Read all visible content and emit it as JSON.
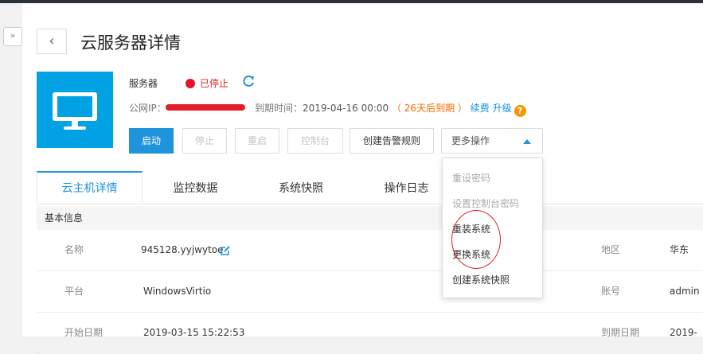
{
  "nav": {
    "toggle_glyph": "»",
    "back_glyph": "‹"
  },
  "page_title": "云服务器详情",
  "server": {
    "type_label": "服务器",
    "status": "已停止",
    "ip_label": "公网IP：",
    "expire_label": "到期时间：",
    "expire_date": "2019-04-16 00:00",
    "expire_note": "（ 26天后到期 ）",
    "renew": "续费",
    "upgrade": "升级",
    "help_glyph": "?"
  },
  "actions": {
    "start": "启动",
    "stop": "停止",
    "restart": "重启",
    "console": "控制台",
    "create_alert": "创建告警规则",
    "more": "更多操作"
  },
  "more_menu": [
    {
      "label": "重设密码",
      "enabled": false
    },
    {
      "label": "设置控制台密码",
      "enabled": false
    },
    {
      "label": "重装系统",
      "enabled": true
    },
    {
      "label": "更换系统",
      "enabled": true
    },
    {
      "label": "创建系统快照",
      "enabled": true
    }
  ],
  "tabs": [
    "云主机详情",
    "监控数据",
    "系统快照",
    "操作日志"
  ],
  "active_tab": "云主机详情",
  "section_title": "基本信息",
  "rows": [
    {
      "k1": "名称",
      "v1": "945128.yyjwytoe",
      "k2": "地区",
      "v2": "华东"
    },
    {
      "k1": "平台",
      "v1": "WindowsVirtio",
      "k2": "账号",
      "v2": "admin"
    },
    {
      "k1": "开始日期",
      "v1": "2019-03-15 15:22:53",
      "k2": "到期日期",
      "v2": "2019-"
    }
  ],
  "colors": {
    "accent": "#1e94dd",
    "status_red": "#e8102a",
    "warn": "#ff6a00",
    "thumb": "#00a2e4"
  },
  "icons": [
    "sidebar-toggle-icon",
    "back-arrow-icon",
    "monitor-icon",
    "refresh-icon",
    "help-icon",
    "edit-icon",
    "caret-up-icon"
  ]
}
